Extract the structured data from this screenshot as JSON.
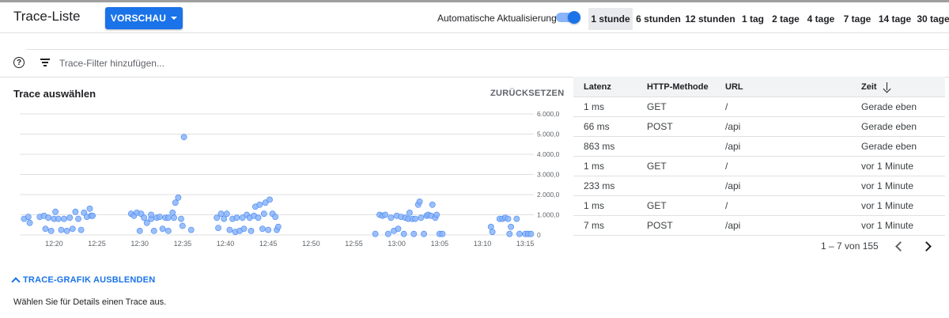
{
  "header": {
    "title": "Trace-Liste",
    "preview_button": "VORSCHAU",
    "auto_refresh_label": "Automatische Aktualisierung",
    "auto_refresh_on": true,
    "time_ranges": [
      "1 stunde",
      "6 stunden",
      "12 stunden",
      "1 tag",
      "2 tage",
      "4 tage",
      "7 tage",
      "14 tage",
      "30 tage"
    ],
    "active_range": "1 stunde"
  },
  "filter": {
    "placeholder": "Trace-Filter hinzufügen..."
  },
  "chart_panel": {
    "title": "Trace auswählen",
    "reset_label": "ZURÜCKSETZEN"
  },
  "chart_data": {
    "type": "scatter",
    "ylim": [
      0,
      6000
    ],
    "yticks": [
      "6.000,0",
      "5.000,0",
      "4.000,0",
      "3.000,0",
      "2.000,0",
      "1.000,0",
      "0"
    ],
    "xticks": [
      "12:20",
      "12:25",
      "12:30",
      "12:35",
      "12:40",
      "12:45",
      "12:50",
      "12:55",
      "13:00",
      "13:05",
      "13:10",
      "13:15"
    ],
    "xlim": [
      "12:16",
      "13:16"
    ],
    "grid": true,
    "point_color": "#8ab4f8",
    "series": [
      {
        "points": [
          [
            "12:16:30",
            800
          ],
          [
            "12:17:00",
            900
          ],
          [
            "12:17:10",
            600
          ],
          [
            "12:18:20",
            900
          ],
          [
            "12:18:50",
            950
          ],
          [
            "12:19:00",
            300
          ],
          [
            "12:19:20",
            850
          ],
          [
            "12:19:40",
            200
          ],
          [
            "12:20:00",
            800
          ],
          [
            "12:20:10",
            1150
          ],
          [
            "12:20:30",
            800
          ],
          [
            "12:20:50",
            250
          ],
          [
            "12:21:10",
            800
          ],
          [
            "12:21:30",
            200
          ],
          [
            "12:21:50",
            850
          ],
          [
            "12:22:10",
            300
          ],
          [
            "12:22:30",
            1150
          ],
          [
            "12:22:50",
            800
          ],
          [
            "12:23:10",
            250
          ],
          [
            "12:23:30",
            1100
          ],
          [
            "12:23:50",
            900
          ],
          [
            "12:24:10",
            1300
          ],
          [
            "12:24:20",
            950
          ],
          [
            "12:24:30",
            950
          ],
          [
            "12:29:00",
            1050
          ],
          [
            "12:29:20",
            950
          ],
          [
            "12:29:40",
            1100
          ],
          [
            "12:30:00",
            200
          ],
          [
            "12:30:10",
            1050
          ],
          [
            "12:30:30",
            850
          ],
          [
            "12:30:50",
            600
          ],
          [
            "12:31:20",
            800
          ],
          [
            "12:31:20",
            1000
          ],
          [
            "12:31:40",
            200
          ],
          [
            "12:32:00",
            850
          ],
          [
            "12:32:20",
            900
          ],
          [
            "12:32:40",
            300
          ],
          [
            "12:33:00",
            850
          ],
          [
            "12:33:20",
            850
          ],
          [
            "12:33:20",
            200
          ],
          [
            "12:33:50",
            1100
          ],
          [
            "12:34:00",
            850
          ],
          [
            "12:34:10",
            1600
          ],
          [
            "12:34:30",
            1850
          ],
          [
            "12:34:50",
            800
          ],
          [
            "12:35:00",
            450
          ],
          [
            "12:35:10",
            4850
          ],
          [
            "12:36:00",
            250
          ],
          [
            "12:39:00",
            850
          ],
          [
            "12:39:10",
            350
          ],
          [
            "12:39:30",
            1050
          ],
          [
            "12:39:50",
            800
          ],
          [
            "12:40:10",
            1050
          ],
          [
            "12:40:30",
            250
          ],
          [
            "12:40:50",
            800
          ],
          [
            "12:41:10",
            150
          ],
          [
            "12:41:20",
            850
          ],
          [
            "12:41:40",
            200
          ],
          [
            "12:42:00",
            850
          ],
          [
            "12:42:10",
            300
          ],
          [
            "12:42:30",
            1000
          ],
          [
            "12:42:50",
            850
          ],
          [
            "12:43:00",
            200
          ],
          [
            "12:43:20",
            950
          ],
          [
            "12:43:30",
            1400
          ],
          [
            "12:43:50",
            850
          ],
          [
            "12:44:00",
            1500
          ],
          [
            "12:44:20",
            300
          ],
          [
            "12:44:30",
            1050
          ],
          [
            "12:44:40",
            1600
          ],
          [
            "12:45:00",
            250
          ],
          [
            "12:45:10",
            1750
          ],
          [
            "12:45:30",
            1050
          ],
          [
            "12:45:50",
            900
          ],
          [
            "12:46:00",
            250
          ],
          [
            "12:46:10",
            400
          ],
          [
            "12:57:30",
            50
          ],
          [
            "12:58:00",
            1000
          ],
          [
            "12:58:20",
            950
          ],
          [
            "12:58:40",
            1000
          ],
          [
            "12:59:00",
            50
          ],
          [
            "12:59:20",
            850
          ],
          [
            "12:59:40",
            200
          ],
          [
            "13:00:00",
            950
          ],
          [
            "13:00:10",
            300
          ],
          [
            "13:00:30",
            900
          ],
          [
            "13:00:50",
            50
          ],
          [
            "13:01:00",
            850
          ],
          [
            "13:01:20",
            800
          ],
          [
            "13:01:30",
            1100
          ],
          [
            "13:01:50",
            800
          ],
          [
            "13:02:00",
            50
          ],
          [
            "13:02:10",
            800
          ],
          [
            "13:02:30",
            1500
          ],
          [
            "13:02:40",
            1650
          ],
          [
            "13:02:50",
            850
          ],
          [
            "13:03:10",
            50
          ],
          [
            "13:03:30",
            950
          ],
          [
            "13:03:40",
            1000
          ],
          [
            "13:04:00",
            950
          ],
          [
            "13:04:10",
            1500
          ],
          [
            "13:04:30",
            850
          ],
          [
            "13:04:40",
            1000
          ],
          [
            "13:05:00",
            50
          ],
          [
            "13:05:20",
            50
          ],
          [
            "13:11:00",
            400
          ],
          [
            "13:11:10",
            150
          ],
          [
            "13:12:00",
            800
          ],
          [
            "13:12:20",
            800
          ],
          [
            "13:12:40",
            850
          ],
          [
            "13:13:00",
            800
          ],
          [
            "13:13:10",
            50
          ],
          [
            "13:13:20",
            400
          ],
          [
            "13:14:00",
            800
          ],
          [
            "13:14:20",
            50
          ],
          [
            "13:15:00",
            50
          ],
          [
            "13:15:20",
            50
          ],
          [
            "13:15:40",
            50
          ]
        ]
      }
    ]
  },
  "table": {
    "columns": [
      "Latenz",
      "HTTP-Methode",
      "URL",
      "Zeit"
    ],
    "rows": [
      [
        "1 ms",
        "GET",
        "/",
        "Gerade eben"
      ],
      [
        "66 ms",
        "POST",
        "/api",
        "Gerade eben"
      ],
      [
        "863 ms",
        "",
        "/api",
        "Gerade eben"
      ],
      [
        "1 ms",
        "GET",
        "/",
        "vor 1 Minute"
      ],
      [
        "233 ms",
        "",
        "/api",
        "vor 1 Minute"
      ],
      [
        "1 ms",
        "GET",
        "/",
        "vor 1 Minute"
      ],
      [
        "7 ms",
        "POST",
        "/api",
        "vor 1 Minute"
      ]
    ],
    "pagination": "1 – 7 von 155"
  },
  "footer": {
    "hide_graph_label": "TRACE-GRAFIK AUSBLENDEN",
    "hint": "Wählen Sie für Details einen Trace aus."
  }
}
